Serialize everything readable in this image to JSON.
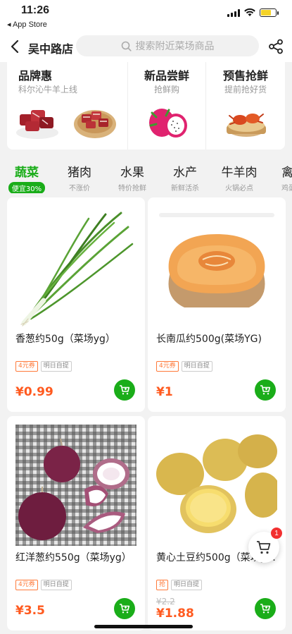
{
  "status": {
    "time": "11:26",
    "back_app": "◂ App Store"
  },
  "header": {
    "title": "吴中路店",
    "search_placeholder": "搜索附近菜场商品"
  },
  "promo": [
    {
      "title": "品牌惠",
      "subtitle": "科尔沁牛羊上线"
    },
    {
      "title": "新品尝鲜",
      "subtitle": "抢鲜购"
    },
    {
      "title": "预售抢鲜",
      "subtitle": "提前抢好货"
    }
  ],
  "categories": [
    {
      "name": "蔬菜",
      "sub": "便宜30%",
      "active": true
    },
    {
      "name": "猪肉",
      "sub": "不涨价"
    },
    {
      "name": "水果",
      "sub": "特价抢鲜"
    },
    {
      "name": "水产",
      "sub": "新鲜活杀"
    },
    {
      "name": "牛羊肉",
      "sub": "火锅必点"
    },
    {
      "name": "禽",
      "sub": "鸡蛋"
    }
  ],
  "products": [
    {
      "name": "香葱约50g（菜场yg）",
      "tags": [
        "4元券",
        "明日自提"
      ],
      "price": "¥0.99",
      "icon": "green-onion-icon"
    },
    {
      "name": "长南瓜约500g(菜场YG)",
      "tags": [
        "4元券",
        "明日自提"
      ],
      "price": "¥1",
      "icon": "pumpkin-icon"
    },
    {
      "name": "红洋葱约550g（菜场yg）",
      "tags": [
        "4元券",
        "明日自提"
      ],
      "price": "¥3.5",
      "icon": "red-onion-icon"
    },
    {
      "name": "黄心土豆约500g（菜场yg）",
      "tags": [
        "抢",
        "明日自提"
      ],
      "old_price": "¥2.2",
      "price": "¥1.88",
      "icon": "potato-icon"
    }
  ],
  "cart": {
    "count": "1"
  },
  "colors": {
    "accent": "#1aad19",
    "price": "#ff5a1f",
    "coupon": "#ff7a3a",
    "badge": "#f23030"
  }
}
